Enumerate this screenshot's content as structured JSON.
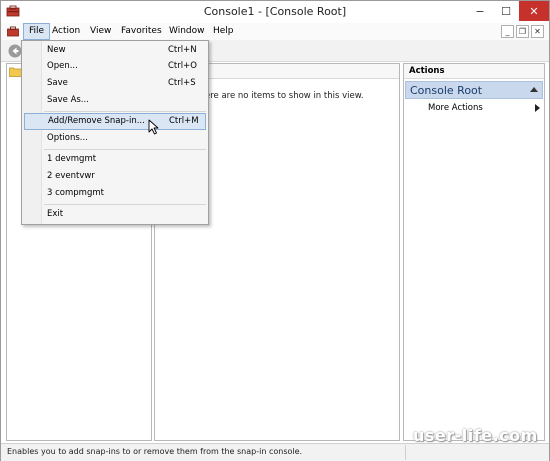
{
  "window": {
    "title": "Console1 - [Console Root]",
    "minimize": "−",
    "maximize": "☐",
    "close": "✕"
  },
  "menubar": {
    "items": [
      "File",
      "Action",
      "View",
      "Favorites",
      "Window",
      "Help"
    ],
    "active": "File",
    "mdi_min": "_",
    "mdi_restore": "❐",
    "mdi_close": "✕"
  },
  "file_menu": {
    "items": [
      {
        "label": "New",
        "shortcut": "Ctrl+N"
      },
      {
        "label": "Open...",
        "shortcut": "Ctrl+O"
      },
      {
        "label": "Save",
        "shortcut": "Ctrl+S"
      },
      {
        "label": "Save As...",
        "shortcut": ""
      },
      {
        "label": "Add/Remove Snap-in...",
        "shortcut": "Ctrl+M",
        "highlighted": true
      },
      {
        "label": "Options...",
        "shortcut": ""
      },
      {
        "label": "1 devmgmt",
        "shortcut": ""
      },
      {
        "label": "2 eventvwr",
        "shortcut": ""
      },
      {
        "label": "3 compmgmt",
        "shortcut": ""
      },
      {
        "label": "Exit",
        "shortcut": ""
      }
    ]
  },
  "center": {
    "empty_message": "ere are no items to show in this view."
  },
  "actions": {
    "header": "Actions",
    "section_title": "Console Root",
    "items": [
      "More Actions"
    ]
  },
  "statusbar": {
    "text": "Enables you to add snap-ins to or remove them from the snap-in console."
  },
  "watermark": "user-life.com",
  "colors": {
    "highlight": "#dae6f4",
    "highlight_border": "#8fb0d6",
    "close_button": "#c7312b",
    "actions_section": "#c9d8ec"
  },
  "icons": {
    "app": "mmc-toolbox-icon",
    "back": "back-arrow-icon",
    "folder": "folder-icon",
    "cursor": "mouse-pointer-icon"
  }
}
